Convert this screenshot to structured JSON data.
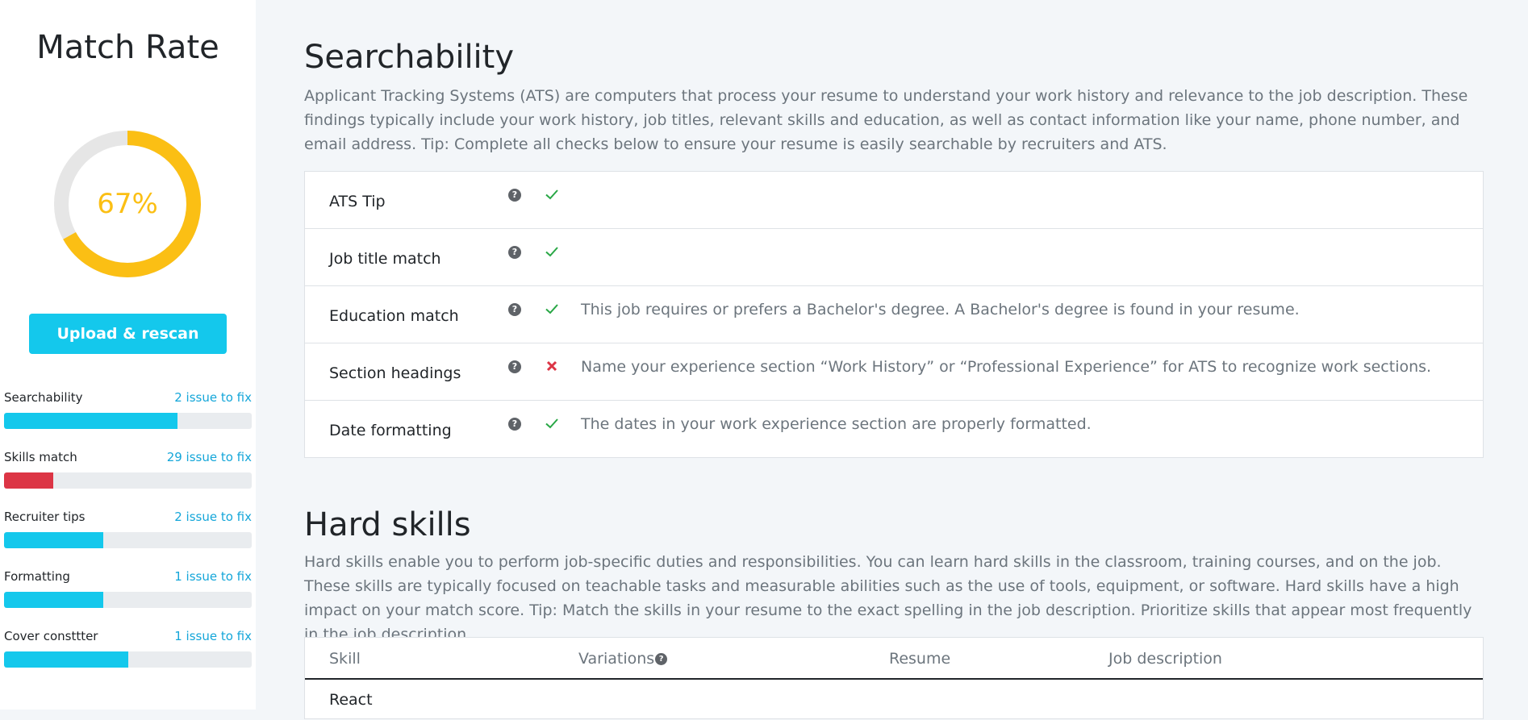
{
  "sidebar": {
    "title": "Match Rate",
    "match_rate": {
      "label": "67%",
      "fraction": 0.67,
      "color": "#fbbf14",
      "track_color": "#e6e6e6"
    },
    "upload_button": "Upload & rescan",
    "metrics": [
      {
        "label": "Searchability",
        "link": "2 issue to fix",
        "fraction": 0.7,
        "color": "#14c8ec"
      },
      {
        "label": "Skills match",
        "link": "29 issue to fix",
        "fraction": 0.2,
        "color": "#dc3545"
      },
      {
        "label": "Recruiter tips",
        "link": "2 issue to fix",
        "fraction": 0.4,
        "color": "#14c8ec"
      },
      {
        "label": "Formatting",
        "link": "1 issue to fix",
        "fraction": 0.4,
        "color": "#14c8ec"
      },
      {
        "label": "Cover consttter",
        "link": "1 issue to fix",
        "fraction": 0.5,
        "color": "#14c8ec"
      }
    ]
  },
  "searchability": {
    "title": "Searchability",
    "description": "Applicant Tracking Systems (ATS) are computers that process your resume to understand your work history and relevance to the job description. These findings typically include your work history, job titles, relevant skills and education, as well as contact information like your name, phone number, and email address. Tip: Complete all checks below to ensure your resume is easily searchable by recruiters and ATS.",
    "help_glyph": "?",
    "checks": [
      {
        "label": "ATS Tip",
        "status": "pass",
        "message": ""
      },
      {
        "label": "Job title match",
        "status": "pass",
        "message": ""
      },
      {
        "label": "Education match",
        "status": "pass",
        "message": "This job requires or prefers a Bachelor's degree. A Bachelor's degree is found in your resume."
      },
      {
        "label": "Section headings",
        "status": "fail",
        "message": "Name your experience section “Work History” or “Professional Experience” for ATS to recognize work sections."
      },
      {
        "label": "Date formatting",
        "status": "pass",
        "message": "The dates in your work experience section are properly formatted."
      }
    ],
    "status_colors": {
      "pass": "#28a745",
      "fail": "#dc3545"
    }
  },
  "hard_skills": {
    "title": "Hard skills",
    "description": "Hard skills enable you to perform job-specific duties and responsibilities. You can learn hard skills in the classroom, training courses, and on the job. These skills are typically focused on teachable tasks and measurable abilities such as the use of tools, equipment, or software. Hard skills have a high impact on your match score. Tip: Match the skills in your resume to the exact spelling in the job description. Prioritize skills that appear most frequently in the job description.",
    "columns": [
      "Skill",
      "Variations",
      "Resume",
      "Job description"
    ],
    "help_glyph": "?",
    "rows": [
      {
        "skill": "React"
      }
    ]
  }
}
